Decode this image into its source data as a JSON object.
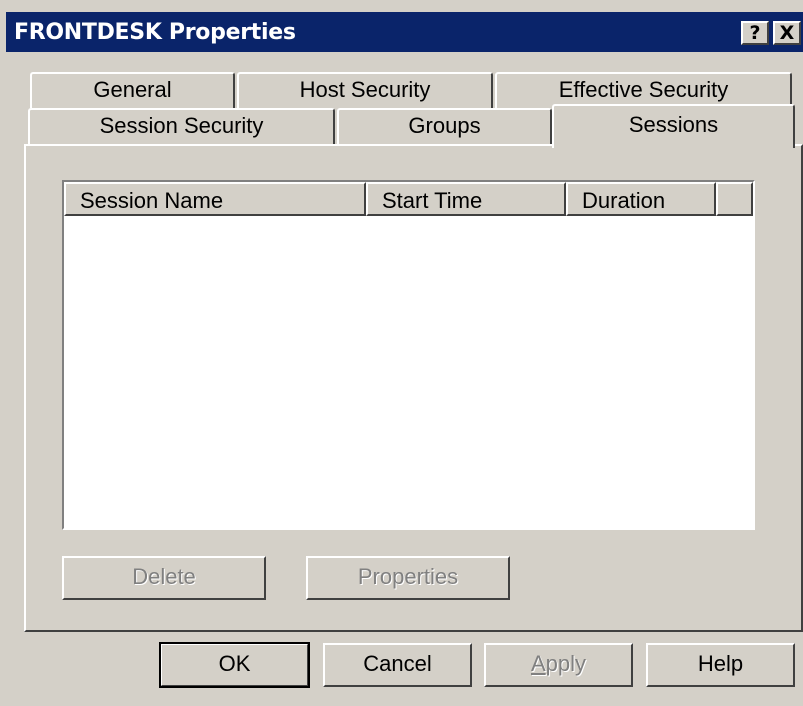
{
  "window": {
    "title": "FRONTDESK Properties",
    "help_glyph": "?",
    "close_glyph": "X"
  },
  "tabs": {
    "row1": [
      "General",
      "Host Security",
      "Effective Security"
    ],
    "row2": [
      "Session Security",
      "Groups",
      "Sessions"
    ],
    "active": "Sessions"
  },
  "list": {
    "columns": [
      "Session Name",
      "Start Time",
      "Duration",
      ""
    ],
    "rows": []
  },
  "panel_buttons": {
    "delete": "Delete",
    "properties": "Properties"
  },
  "dialog_buttons": {
    "ok": "OK",
    "cancel": "Cancel",
    "apply": "Apply",
    "help": "Help"
  },
  "colors": {
    "titlebar": "#0a246a",
    "face": "#d4d0c8",
    "disabled_text": "#808080"
  }
}
